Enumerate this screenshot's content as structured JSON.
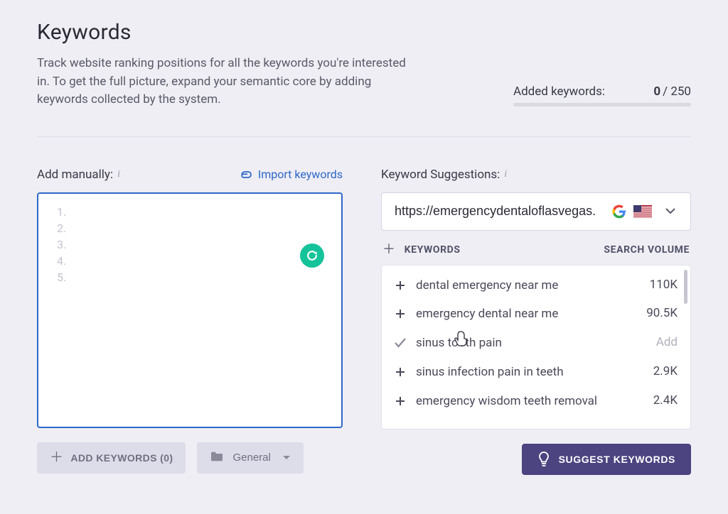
{
  "header": {
    "title": "Keywords",
    "description": "Track website ranking positions for all the keywords you're interested in. To get the full picture, expand your semantic core by adding keywords collected by the system.",
    "quota_label": "Added keywords:",
    "quota_current": "0",
    "quota_max": "250"
  },
  "manual": {
    "label": "Add manually:",
    "import_label": "Import keywords",
    "placeholder_rows": 5,
    "add_button_label": "ADD KEYWORDS (0)",
    "folder_label": "General"
  },
  "suggestions": {
    "label": "Keyword Suggestions:",
    "url_value": "https://emergencydentaloflasvegas.",
    "col_keywords": "KEYWORDS",
    "col_volume": "SEARCH VOLUME",
    "add_placeholder": "Add",
    "items": [
      {
        "kw": "dental emergency near me",
        "vol": "110K",
        "checked": false
      },
      {
        "kw": "emergency dental near me",
        "vol": "90.5K",
        "checked": false
      },
      {
        "kw": "sinus tooth pain",
        "vol": "Add",
        "checked": true
      },
      {
        "kw": "sinus infection pain in teeth",
        "vol": "2.9K",
        "checked": false
      },
      {
        "kw": "emergency wisdom teeth removal",
        "vol": "2.4K",
        "checked": false
      }
    ],
    "suggest_button_label": "SUGGEST KEYWORDS"
  }
}
